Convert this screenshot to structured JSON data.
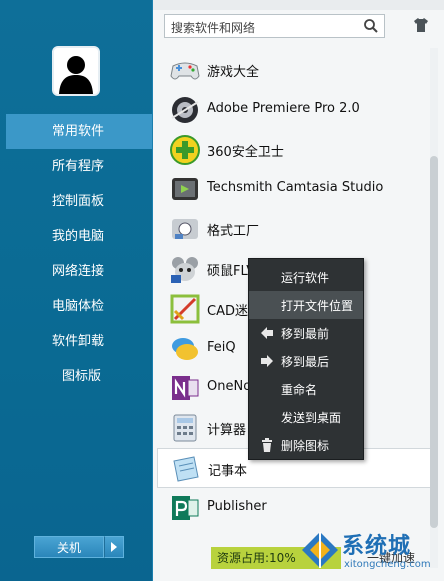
{
  "search": {
    "placeholder": "搜索软件和网络"
  },
  "sidebar": {
    "items": [
      {
        "label": "常用软件",
        "active": true
      },
      {
        "label": "所有程序"
      },
      {
        "label": "控制面板"
      },
      {
        "label": "我的电脑"
      },
      {
        "label": "网络连接"
      },
      {
        "label": "电脑体检"
      },
      {
        "label": "软件卸载"
      },
      {
        "label": "图标版"
      }
    ],
    "power_label": "关机"
  },
  "apps": [
    {
      "label": "游戏大全",
      "icon": "gamepad-icon"
    },
    {
      "label": "Adobe Premiere Pro 2.0",
      "icon": "premiere-icon"
    },
    {
      "label": "360安全卫士",
      "icon": "shield-plus-icon"
    },
    {
      "label": "Techsmith Camtasia Studio",
      "icon": "camtasia-icon"
    },
    {
      "label": "格式工厂",
      "icon": "format-factory-icon"
    },
    {
      "label": "硕鼠FLV视频下载器",
      "icon": "mouse-downloader-icon"
    },
    {
      "label": "CAD迷你看图",
      "icon": "cad-viewer-icon"
    },
    {
      "label": "FeiQ",
      "icon": "feiq-icon"
    },
    {
      "label": "OneNote",
      "icon": "onenote-icon"
    },
    {
      "label": "计算器",
      "icon": "calculator-icon"
    },
    {
      "label": "记事本",
      "icon": "notepad-icon",
      "highlighted": true
    },
    {
      "label": "Publisher",
      "icon": "publisher-icon"
    }
  ],
  "context_menu": [
    {
      "label": "运行软件",
      "icon": ""
    },
    {
      "label": "打开文件位置",
      "icon": "",
      "hover": true
    },
    {
      "label": "移到最前",
      "icon": "arrow-left-icon"
    },
    {
      "label": "移到最后",
      "icon": "arrow-right-icon"
    },
    {
      "label": "重命名",
      "icon": ""
    },
    {
      "label": "发送到桌面",
      "icon": ""
    },
    {
      "label": "删除图标",
      "icon": "trash-icon"
    }
  ],
  "status": {
    "resource_label": "资源占用:10%",
    "accel_label": "一键加速"
  },
  "watermark": {
    "brand": "系统城",
    "url": "xitongcheng.com"
  },
  "colors": {
    "sidebar_bg": "#0e6f99",
    "active_item": "#3b98c8",
    "status_bar": "#b8d23d",
    "menu_bg": "#2e3234"
  }
}
